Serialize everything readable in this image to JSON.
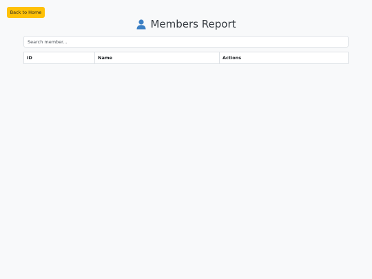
{
  "header": {
    "back_label": "Back to Home",
    "title": "Members Report",
    "title_icon": "user-icon"
  },
  "search": {
    "placeholder": "Search member...",
    "value": ""
  },
  "table": {
    "columns": [
      "ID",
      "Name",
      "Actions"
    ],
    "rows": []
  },
  "colors": {
    "background": "#f8f9fa",
    "accent_button": "#ffc107",
    "icon": "#3b7fc4"
  }
}
